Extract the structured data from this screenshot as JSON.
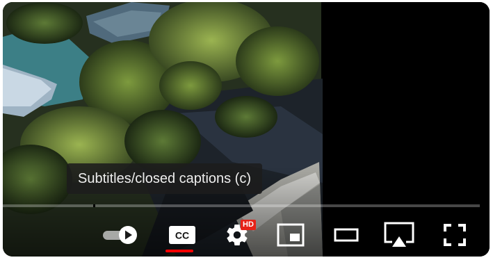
{
  "player": {
    "tooltip": "Subtitles/closed captions (c)",
    "captions_on": true,
    "autoplay_on": true,
    "settings_badge": "HD",
    "accent_color": "#ff0000",
    "badge_color": "#e62117"
  },
  "controls": [
    {
      "name": "autoplay-toggle",
      "icon": "autoplay-toggle-icon"
    },
    {
      "name": "subtitles-button",
      "icon": "cc-icon"
    },
    {
      "name": "settings-button",
      "icon": "gear-icon"
    },
    {
      "name": "miniplayer-button",
      "icon": "miniplayer-icon"
    },
    {
      "name": "theater-mode-button",
      "icon": "theater-icon"
    },
    {
      "name": "airplay-button",
      "icon": "airplay-icon"
    },
    {
      "name": "fullscreen-button",
      "icon": "fullscreen-icon"
    }
  ]
}
